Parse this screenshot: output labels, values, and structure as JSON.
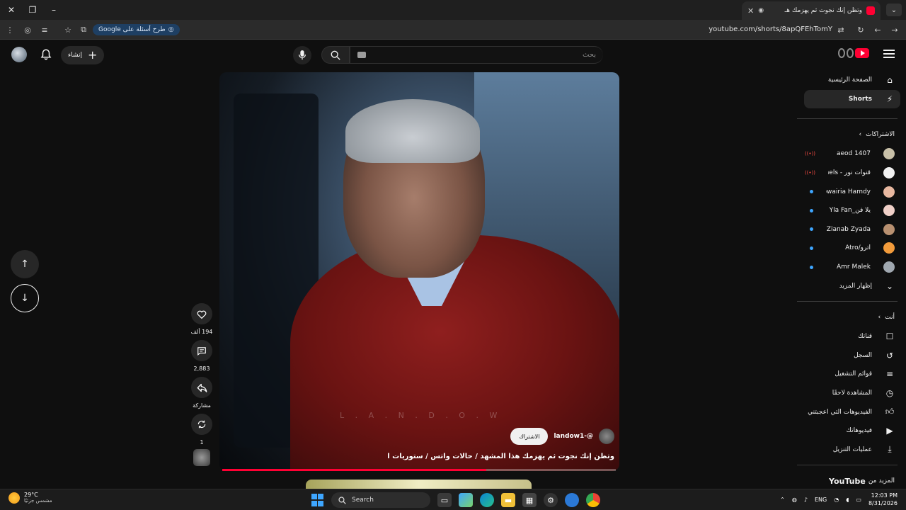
{
  "browser": {
    "tab_title": "وتظن إنك نجوت ثم يهزمك هـ",
    "url": "youtube.com/shorts/8apQFEhTomY",
    "ask_google": "طرح أسئلة على Google"
  },
  "header": {
    "search_placeholder": "بحث",
    "create_label": "إنشاء"
  },
  "sidebar": {
    "home": "الصفحة الرئيسية",
    "shorts": "Shorts",
    "subscriptions_title": "الاشتراكات",
    "subscriptions": [
      {
        "name": "aeod 1407",
        "status": "live",
        "color": "#c8c0a8"
      },
      {
        "name": "قنوات نور - hannels...",
        "status": "live",
        "color": "#f1f1f1"
      },
      {
        "name": "Jowairia Hamdy",
        "status": "new",
        "color": "#e8b8a0"
      },
      {
        "name": "يلا فن_Yla Fan",
        "status": "new",
        "color": "#f0d0c8"
      },
      {
        "name": "Zianab Zyada",
        "status": "new",
        "color": "#b89070"
      },
      {
        "name": "أترو/Atro",
        "status": "new",
        "color": "#f29b3b"
      },
      {
        "name": "Amr Malek",
        "status": "new",
        "color": "#a0a8b0"
      }
    ],
    "show_more": "إظهار المزيد",
    "you_title": "أنت",
    "you_items": [
      {
        "label": "قناتك",
        "icon": "person-icon"
      },
      {
        "label": "السجل",
        "icon": "history-icon"
      },
      {
        "label": "قوائم التشغيل",
        "icon": "playlist-icon"
      },
      {
        "label": "المشاهدة لاحقًا",
        "icon": "clock-icon"
      },
      {
        "label": "الفيديوهات التي أعجبتني",
        "icon": "thumb-up-icon"
      },
      {
        "label": "فيديوهاتك",
        "icon": "video-icon"
      },
      {
        "label": "عمليات التنزيل",
        "icon": "download-icon"
      }
    ],
    "more_from_prefix": "المزيد من",
    "more_from_brand": "YouTube"
  },
  "short": {
    "watermark": "L . A . N . D . O . W",
    "channel_handle": "@-landow1",
    "subscribe_label": "الاشتراك",
    "title": "وتظن إنك نجوت ثم يهزمك هذا المشهد / حالات واتس / ستوريات انستا ...",
    "progress": 0.67
  },
  "actions": {
    "likes": "194 ألف",
    "comments": "2,883",
    "share": "مشاركة",
    "remix": "1"
  },
  "taskbar": {
    "temp": "29°C",
    "weather": "مشمس جزئيًا",
    "search": "Search",
    "lang": "ENG",
    "time": "12:03 PM",
    "date": "8/31/2026"
  }
}
